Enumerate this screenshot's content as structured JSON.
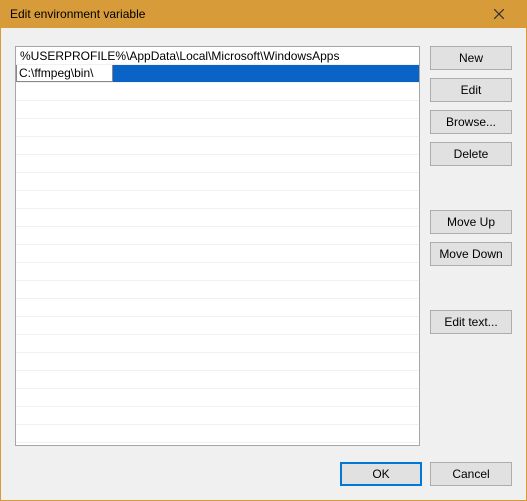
{
  "window": {
    "title": "Edit environment variable"
  },
  "list": {
    "items": [
      "%USERPROFILE%\\AppData\\Local\\Microsoft\\WindowsApps",
      "C:\\ffmpeg\\bin\\"
    ],
    "editing_index": 1,
    "edit_value": "C:\\ffmpeg\\bin\\"
  },
  "buttons": {
    "new": "New",
    "edit": "Edit",
    "browse": "Browse...",
    "delete": "Delete",
    "move_up": "Move Up",
    "move_down": "Move Down",
    "edit_text": "Edit text...",
    "ok": "OK",
    "cancel": "Cancel"
  }
}
